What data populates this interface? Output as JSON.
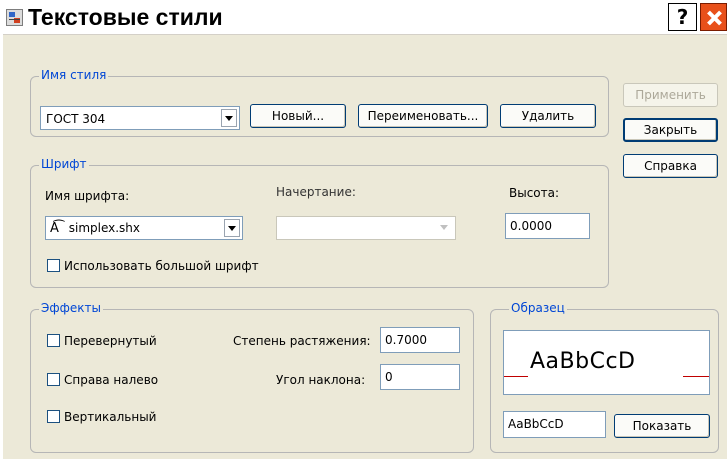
{
  "window": {
    "title": "Текстовые стили"
  },
  "title_buttons": {
    "help_label": "?"
  },
  "style_name": {
    "legend": "Имя стиля",
    "selected": "ГОСТ 304",
    "new_label": "Новый...",
    "rename_label": "Переименовать...",
    "delete_label": "Удалить"
  },
  "side_buttons": {
    "apply_label": "Применить",
    "close_label": "Закрыть",
    "help_label": "Справка"
  },
  "font": {
    "legend": "Шрифт",
    "font_name_label": "Имя шрифта:",
    "font_name_value": "simplex.shx",
    "style_label": "Начертание:",
    "style_value": "",
    "height_label": "Высота:",
    "height_value": "0.0000",
    "big_font_label": "Использовать большой шрифт",
    "big_font_checked": false
  },
  "effects": {
    "legend": "Эффекты",
    "upside_down_label": "Перевернутый",
    "upside_down_checked": false,
    "backwards_label": "Справа налево",
    "backwards_checked": false,
    "vertical_label": "Вертикальный",
    "vertical_checked": false,
    "width_factor_label": "Степень растяжения:",
    "width_factor_value": "0.7000",
    "oblique_label": "Угол наклона:",
    "oblique_value": "0"
  },
  "preview": {
    "legend": "Образец",
    "sample_text": "AaBbCcD",
    "input_value": "AaBbCcD",
    "show_label": "Показать"
  },
  "colors": {
    "legend_blue": "#0046d5",
    "close_red": "#e8501a",
    "baseline_red": "#c00000"
  }
}
